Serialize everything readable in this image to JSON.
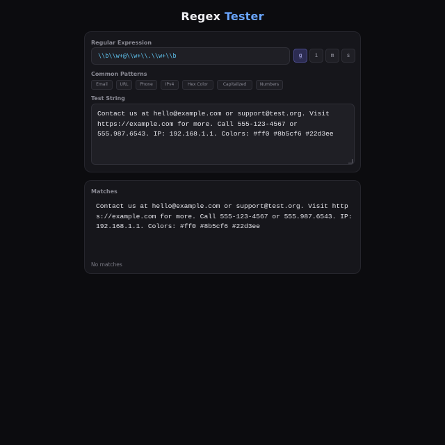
{
  "app": {
    "title_part1": "Regex",
    "title_part2": "Tester"
  },
  "regex": {
    "label": "Regular Expression",
    "value": "\\\\b\\\\w+@\\\\w+\\\\.\\\\w+\\\\b",
    "flags": [
      {
        "label": "g",
        "active": true
      },
      {
        "label": "i",
        "active": false
      },
      {
        "label": "m",
        "active": false
      },
      {
        "label": "s",
        "active": false
      }
    ]
  },
  "patterns": {
    "label": "Common Patterns",
    "items": [
      "Email",
      "URL",
      "Phone",
      "IPv4",
      "Hex Color",
      "Capitalized",
      "Numbers"
    ]
  },
  "test": {
    "label": "Test String",
    "value": "Contact us at hello@example.com or support@test.org. Visit https://example.com for more. Call 555-123-4567 or 555.987.6543. IP: 192.168.1.1. Colors: #ff0 #8b5cf6 #22d3ee"
  },
  "matches": {
    "label": "Matches",
    "text": "Contact us at hello@example.com or support@test.org. Visit https://example.com for more. Call 555-123-4567 or 555.987.6543. IP: 192.168.1.1. Colors: #ff0 #8b5cf6 #22d3ee",
    "status": "No matches"
  }
}
